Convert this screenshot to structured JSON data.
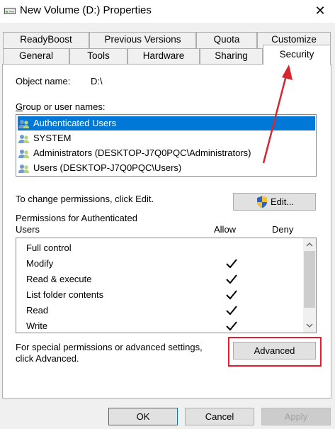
{
  "window": {
    "title": "New Volume (D:) Properties",
    "close_glyph": "✕"
  },
  "tabs_row1": [
    "ReadyBoost",
    "Previous Versions",
    "Quota",
    "Customize"
  ],
  "tabs_row2": [
    "General",
    "Tools",
    "Hardware",
    "Sharing",
    "Security"
  ],
  "active_tab": "Security",
  "security": {
    "object_name_label": "Object name:",
    "object_name_value": "D:\\",
    "group_label": "Group or user names:",
    "users": [
      {
        "name": "Authenticated Users",
        "selected": true
      },
      {
        "name": "SYSTEM",
        "selected": false
      },
      {
        "name": "Administrators (DESKTOP-J7Q0PQC\\Administrators)",
        "selected": false
      },
      {
        "name": "Users (DESKTOP-J7Q0PQC\\Users)",
        "selected": false
      }
    ],
    "change_text": "To change permissions, click Edit.",
    "edit_button": "Edit...",
    "permissions_label_line1": "Permissions for Authenticated",
    "permissions_label_line2": "Users",
    "allow_header": "Allow",
    "deny_header": "Deny",
    "permissions": [
      {
        "name": "Full control",
        "allow": false,
        "deny": false
      },
      {
        "name": "Modify",
        "allow": true,
        "deny": false
      },
      {
        "name": "Read & execute",
        "allow": true,
        "deny": false
      },
      {
        "name": "List folder contents",
        "allow": true,
        "deny": false
      },
      {
        "name": "Read",
        "allow": true,
        "deny": false
      },
      {
        "name": "Write",
        "allow": true,
        "deny": false
      }
    ],
    "special_text_line1": "For special permissions or advanced settings,",
    "special_text_line2": "click Advanced.",
    "advanced_button": "Advanced"
  },
  "footer": {
    "ok": "OK",
    "cancel": "Cancel",
    "apply": "Apply"
  },
  "icons": {
    "drive": "drive-icon",
    "users": "user-group-icon",
    "shield": "uac-shield-icon",
    "check": "checkmark-icon"
  },
  "colors": {
    "selection": "#0078d7",
    "highlight_box": "#e0202c",
    "annotation_arrow": "#d9252f"
  }
}
